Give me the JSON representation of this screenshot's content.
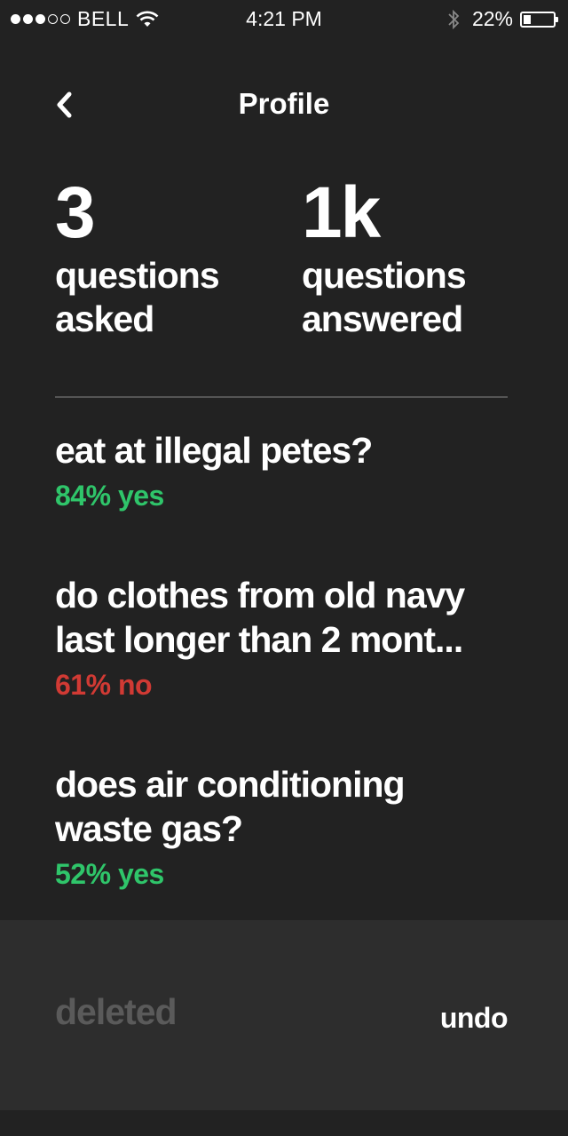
{
  "status_bar": {
    "carrier": "BELL",
    "time": "4:21 PM",
    "battery": "22%",
    "battery_level": 0.22
  },
  "nav": {
    "title": "Profile",
    "back_icon": "chevron-left-icon"
  },
  "stats": {
    "asked": {
      "value": "3",
      "label_line1": "questions",
      "label_line2": "asked"
    },
    "answered": {
      "value": "1k",
      "label_line1": "questions",
      "label_line2": "answered"
    }
  },
  "questions": [
    {
      "title": "eat at illegal petes?",
      "result": "84% yes"
    },
    {
      "title_line1": "do clothes from old navy",
      "title_line2": "last longer than 2 mont...",
      "result": "61% no"
    },
    {
      "title_line1": "does air conditioning",
      "title_line2": "waste gas?",
      "result": "52% yes"
    }
  ],
  "toast": {
    "label": "deleted",
    "action": "undo"
  },
  "colors": {
    "background": "#222222",
    "toast_background": "#2d2d2d",
    "yes": "#2fc56a",
    "no": "#d13a34",
    "muted": "#5a5a5a"
  }
}
